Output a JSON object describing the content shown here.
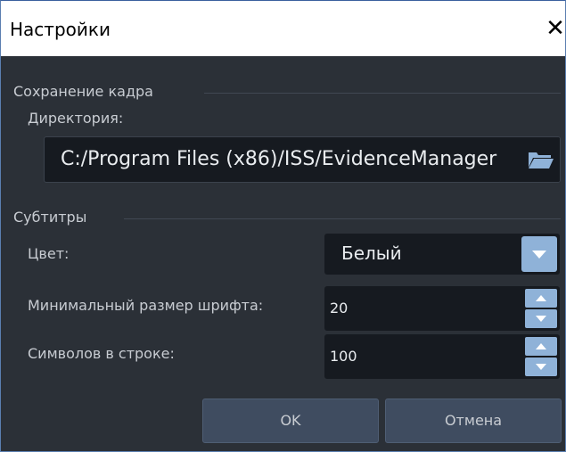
{
  "window": {
    "title": "Настройки",
    "close_glyph": "✕"
  },
  "frame_save": {
    "section_label": "Сохранение кадра",
    "directory_label": "Директория:",
    "directory_value": "C:/Program Files (x86)/ISS/EvidenceManager",
    "browse_icon": "folder-icon"
  },
  "subtitles": {
    "section_label": "Субтитры",
    "color_label": "Цвет:",
    "color_value": "Белый",
    "min_font_label": "Минимальный размер шрифта:",
    "min_font_value": "20",
    "chars_label": "Символов в строке:",
    "chars_value": "100"
  },
  "buttons": {
    "ok": "OK",
    "cancel": "Отмена"
  },
  "colors": {
    "background": "#2b3037",
    "field": "#161a20",
    "accent": "#8fb2d8",
    "button": "#3f4c60"
  }
}
